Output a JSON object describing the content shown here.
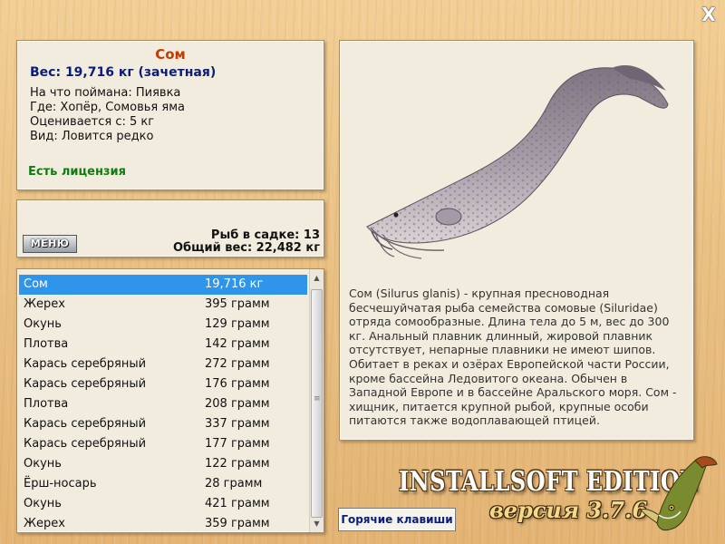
{
  "window": {
    "close_label": "X"
  },
  "info": {
    "fish_name": "Сом",
    "weight": "Вес: 19,716 кг (зачетная)",
    "bait": "На что поймана: Пиявка",
    "place": "Где: Хопёр, Сомовья яма",
    "rated_from": "Оценивается с: 5 кг",
    "kind": "Вид: Ловится редко",
    "license": "Есть лицензия"
  },
  "middle": {
    "menu_label": "МЕНЮ",
    "fish_in_net": "Рыб в садке: 13",
    "total_weight": "Общий вес: 22,482 кг"
  },
  "catch_list": [
    {
      "name": "Сом",
      "weight": "19,716 кг",
      "selected": true
    },
    {
      "name": "Жерех",
      "weight": "395 грамм"
    },
    {
      "name": "Окунь",
      "weight": "129 грамм"
    },
    {
      "name": "Плотва",
      "weight": "142 грамм"
    },
    {
      "name": "Карась серебряный",
      "weight": "272 грамм"
    },
    {
      "name": "Карась серебряный",
      "weight": "176 грамм"
    },
    {
      "name": "Плотва",
      "weight": "208 грамм"
    },
    {
      "name": "Карась серебряный",
      "weight": "337 грамм"
    },
    {
      "name": "Карась серебряный",
      "weight": "177 грамм"
    },
    {
      "name": "Окунь",
      "weight": "122 грамм"
    },
    {
      "name": "Ёрш-носарь",
      "weight": "28 грамм"
    },
    {
      "name": "Окунь",
      "weight": "421 грамм"
    },
    {
      "name": "Жерех",
      "weight": "359 грамм"
    }
  ],
  "description": {
    "lines": [
      "Сом (Silurus glanis) - крупная пресноводная",
      "бесчешуйчатая рыба семейства сомовые (Siluridae)",
      "отряда сомообразные. Длина тела до 5 м, вес до 300",
      "кг. Анальный плавник длинный, жировой плавник",
      "отсутствует, непарные плавники не имеют шипов.",
      "Обитает в реках и озёрах Европейской части России,",
      "кроме бассейна Ледовитого океана. Обычен в",
      "Западной Европе и в бассейне Аральского моря. Сом -",
      "хищник, питается крупной рыбой, крупные особи",
      "питаются также водоплавающей птицей."
    ]
  },
  "footer": {
    "hotkeys_label": "Горячие клавиши",
    "edition": "INSTALLSOFT EDITION",
    "version": "версия 3.7.6"
  },
  "colors": {
    "fish_title": "#c43a00",
    "weight_line": "#0a1d78",
    "license": "#137a12",
    "selection": "#2f95ea",
    "panel_bg": "#f1ecde"
  },
  "icons": {
    "close": "close-icon",
    "catfish": "catfish-image",
    "pike": "pike-logo"
  }
}
